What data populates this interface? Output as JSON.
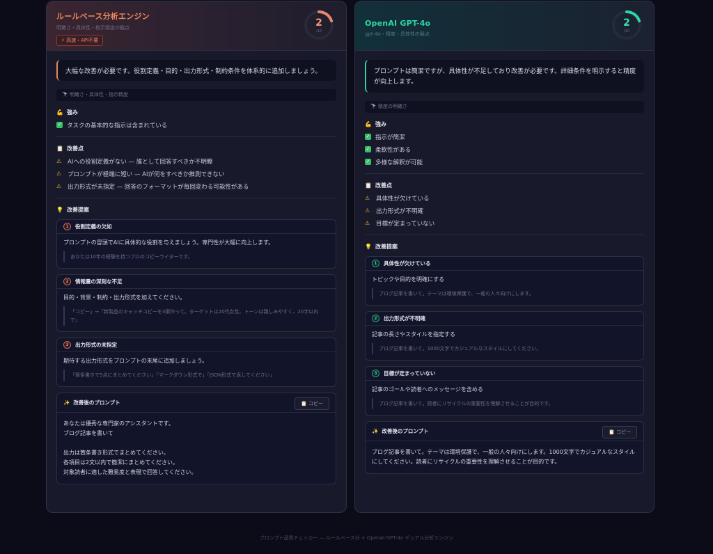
{
  "left": {
    "title": "ルールベース分析エンジン",
    "subtitle": "明確さ・具体性・指示精度の観点",
    "badge": "⚡ 高速・API不要",
    "score": "2",
    "score_label": "/10",
    "summary": "大幅な改善が必要です。役割定義・目的・出力形式・制約条件を体系的に追加しましょう。",
    "tags": "明確さ・具体性・指示精度",
    "strengths_title": "強み",
    "strengths": [
      "タスクの基本的な指示は含まれている"
    ],
    "issues_title": "改善点",
    "issues": [
      "AIへの役割定義がない — 誰として回答すべきか不明瞭",
      "プロンプトが極端に短い — AIが何をすべきか推測できない",
      "出力形式が未指定 — 回答のフォーマットが毎回変わる可能性がある"
    ],
    "suggestions_title": "改善提案",
    "suggestions": [
      {
        "num": "1",
        "title": "役割定義の欠如",
        "text": "プロンプトの冒頭でAIに具体的な役割を与えましょう。専門性が大幅に向上します。",
        "example": "あなたは10年の経験を持つプロのコピーライターです。"
      },
      {
        "num": "2",
        "title": "情報量の深刻な不足",
        "text": "目的・背景・制約・出力形式を加えてください。",
        "example": "「コピー」→「新製品のキャッチコピーを3案作って。ターゲットは20代女性、トーンは親しみやすく、20字以内で」"
      },
      {
        "num": "3",
        "title": "出力形式の未指定",
        "text": "期待する出力形式をプロンプトの末尾に追加しましょう。",
        "example": "「箇条書きで5点にまとめてください」「マークダウン形式で」「JSON形式で返してください」"
      }
    ],
    "final_title": "改善後のプロンプト",
    "copy_label": "コピー",
    "final_lines": [
      "あなたは優秀な専門家のアシスタントです。",
      "ブログ記事を書いて",
      "",
      "出力は箇条書き形式でまとめてください。",
      "各項目は2文以内で簡潔にまとめてください。",
      "対象読者に適した難易度と表現で回答してください。"
    ]
  },
  "right": {
    "title": "OpenAI GPT-4o",
    "subtitle": "gpt-4o・精度・具体性の観点",
    "score": "2",
    "score_label": "/10",
    "summary": "プロンプトは簡潔ですが、具体性が不足しており改善が必要です。詳細条件を明示すると精度が向上します。",
    "tags": "精度の明確さ",
    "strengths_title": "強み",
    "strengths": [
      "指示が簡潔",
      "柔軟性がある",
      "多様な解釈が可能"
    ],
    "issues_title": "改善点",
    "issues": [
      "具体性が欠けている",
      "出力形式が不明確",
      "目標が定まっていない"
    ],
    "suggestions_title": "改善提案",
    "suggestions": [
      {
        "num": "1",
        "title": "具体性が欠けている",
        "text": "トピックや目的を明確にする",
        "example": "ブログ記事を書いて。テーマは環境保護で、一般の人々向けにします。"
      },
      {
        "num": "2",
        "title": "出力形式が不明確",
        "text": "記事の長さやスタイルを指定する",
        "example": "ブログ記事を書いて。1000文字でカジュアルなスタイルにしてください。"
      },
      {
        "num": "3",
        "title": "目標が定まっていない",
        "text": "記事のゴールや読者へのメッセージを含める",
        "example": "ブログ記事を書いて。読者にリサイクルの重要性を理解させることが目的です。"
      }
    ],
    "final_title": "改善後のプロンプト",
    "copy_label": "コピー",
    "final_lines": [
      "ブログ記事を書いて。テーマは環境保護で、一般の人々向けにします。1000文字でカジュアルなスタイル",
      "にしてください。読者にリサイクルの重要性を理解させることが目的です。"
    ]
  },
  "footer": "プロンプト品質チェッカー — ルールベース分 + OpenAI GPT-4o デュアル分析エンジン",
  "colors": {
    "left_accent": "#e8896a",
    "right_accent": "#2fd4a6",
    "check": "#3bbf6a",
    "warn": "#f2b32e"
  },
  "icons": {
    "strengths": "muscle-icon",
    "issues": "clipboard-icon",
    "suggestions": "bulb-icon",
    "final": "sparkles-icon",
    "tags": "telescope-icon"
  },
  "score_fraction": 0.2
}
